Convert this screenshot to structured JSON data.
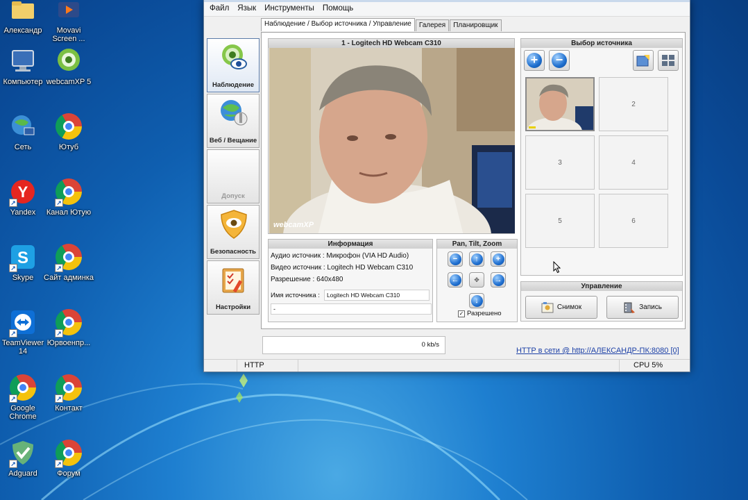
{
  "desktop": {
    "icons": [
      {
        "label": "Александр",
        "icon": "user-folder-icon"
      },
      {
        "label": "Movavi Screen ...",
        "icon": "movavi-icon"
      },
      {
        "label": "Компьютер",
        "icon": "computer-icon"
      },
      {
        "label": "webcamXP 5",
        "icon": "webcamxp-icon"
      },
      {
        "label": "Сеть",
        "icon": "network-icon"
      },
      {
        "label": "Ютуб",
        "icon": "chrome-icon"
      },
      {
        "label": "Yandex",
        "icon": "yandex-icon"
      },
      {
        "label": "Канал Ютую",
        "icon": "chrome-icon"
      },
      {
        "label": "Skype",
        "icon": "skype-icon"
      },
      {
        "label": "Сайт админка",
        "icon": "chrome-icon"
      },
      {
        "label": "TeamViewer 14",
        "icon": "teamviewer-icon"
      },
      {
        "label": "Юрвоенпр...",
        "icon": "chrome-icon"
      },
      {
        "label": "Google Chrome",
        "icon": "chrome-icon"
      },
      {
        "label": "Контакт",
        "icon": "chrome-icon"
      },
      {
        "label": "Adguard",
        "icon": "adguard-icon"
      },
      {
        "label": "Форум",
        "icon": "chrome-icon"
      }
    ]
  },
  "menu": {
    "file": "Файл",
    "language": "Язык",
    "tools": "Инструменты",
    "help": "Помощь"
  },
  "sidebar": {
    "items": [
      {
        "label": "Наблюдение",
        "icon": "eye-camera-icon",
        "active": true
      },
      {
        "label": "Веб / Вещание",
        "icon": "globe-broadcast-icon"
      },
      {
        "label": "Допуск",
        "icon": "access-icon",
        "disabled": true
      },
      {
        "label": "Безопасность",
        "icon": "shield-eye-icon"
      },
      {
        "label": "Настройки",
        "icon": "settings-clipboard-icon"
      }
    ]
  },
  "tabs": [
    {
      "label": "Наблюдение / Выбор источника / Управление",
      "active": true
    },
    {
      "label": "Галерея"
    },
    {
      "label": "Планировщик"
    }
  ],
  "video": {
    "title": "1 - Logitech HD Webcam C310",
    "watermark": "webcamXP"
  },
  "info": {
    "title": "Информация",
    "audio": "Аудио источник : Микрофон (VIA HD Audio)",
    "video_src": "Видео источник : Logitech HD Webcam C310",
    "resolution": "Разрешение : 640x480",
    "name_label": "Имя источника :",
    "name_value": "Logitech HD Webcam C310",
    "extra_value": "-"
  },
  "ptz": {
    "title": "Pan, Tilt, Zoom",
    "allowed_label": "Разрешено",
    "allowed": true
  },
  "source_select": {
    "title": "Выбор источника",
    "cells": [
      "1",
      "2",
      "3",
      "4",
      "5",
      "6"
    ]
  },
  "control": {
    "title": "Управление",
    "snapshot_label": "Снимок",
    "record_label": "Запись"
  },
  "rate": "0 kb/s",
  "http_status": "HTTP в сети @ http://АЛЕКСАНДР-ПК:8080 [0]",
  "statusbar": {
    "protocol": "HTTP",
    "cpu": "CPU 5%"
  },
  "colors": {
    "desktop_bg": "#1e7fd0",
    "accent_blue": "#1e6fcf",
    "link": "#1b3fa6"
  }
}
